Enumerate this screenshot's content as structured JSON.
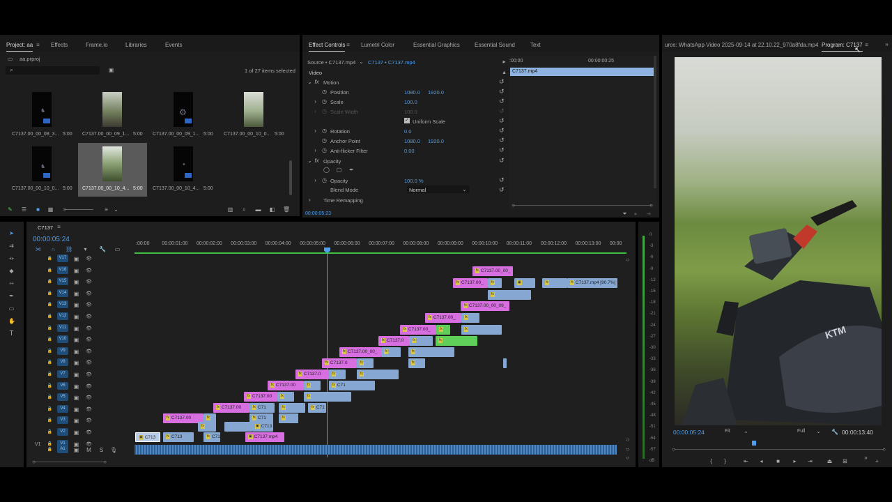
{
  "project_panel": {
    "tabs": [
      "Project: aa",
      "Effects",
      "Frame.io",
      "Libraries",
      "Events"
    ],
    "project_file": "aa.prproj",
    "items_selected": "1 of 27 items selected",
    "bins": [
      {
        "name": "C7137.00_00_08_3...",
        "duration": "5:00"
      },
      {
        "name": "C7137.00_00_09_1...",
        "duration": "5:00"
      },
      {
        "name": "C7137.00_00_09_1...",
        "duration": "5:00"
      },
      {
        "name": "C7137.00_00_10_0...",
        "duration": "5:00"
      },
      {
        "name": "C7137.00_00_10_0...",
        "duration": "5:00"
      },
      {
        "name": "C7137.00_00_10_4...",
        "duration": "5:00"
      },
      {
        "name": "C7137.00_00_10_4...",
        "duration": "5:00"
      }
    ]
  },
  "effect_controls": {
    "tabs": [
      "Effect Controls",
      "Lumetri Color",
      "Essential Graphics",
      "Essential Sound",
      "Text"
    ],
    "source": "Source • C7137.mp4",
    "sequence": "C7137 • C7137.mp4",
    "section_video": "Video",
    "motion": "Motion",
    "position_label": "Position",
    "position_x": "1080.0",
    "position_y": "1920.0",
    "scale_label": "Scale",
    "scale_val": "100.0",
    "scale_width_label": "Scale Width",
    "scale_width_val": "100.0",
    "uniform_scale": "Uniform Scale",
    "rotation_label": "Rotation",
    "rotation_val": "0.0",
    "anchor_label": "Anchor Point",
    "anchor_x": "1080.0",
    "anchor_y": "1920.0",
    "antiflicker_label": "Anti-flicker Filter",
    "antiflicker_val": "0.00",
    "opacity_section": "Opacity",
    "opacity_label": "Opacity",
    "opacity_val": "100.0 %",
    "blend_label": "Blend Mode",
    "blend_val": "Normal",
    "time_remap": "Time Remapping",
    "time_start": ":00:00",
    "time_mark": "00:00:00:25",
    "clip_name": "C7137.mp4",
    "current_time": "00:00:05:23"
  },
  "program": {
    "source_tab": "urce: WhatsApp Video 2025-09-14 at 22.10.22_970a8fda.mp4",
    "program_tab": "Program: C7137",
    "timecode": "00:00:05:24",
    "fit": "Fit",
    "quality": "Full",
    "duration": "00:00:13:40"
  },
  "timeline": {
    "sequence_name": "C7137",
    "timecode": "00:00:05:24",
    "ruler": [
      ":00:00",
      "00:00:01:00",
      "00:00:02:00",
      "00:00:03:00",
      "00:00:04:00",
      "00:00:05:00",
      "00:00:06:00",
      "00:00:07:00",
      "00:00:08:00",
      "00:00:09:00",
      "00:00:10:00",
      "00:00:11:00",
      "00:00:12:00",
      "00:00:13:00",
      "00:00"
    ],
    "tracks": [
      "V17",
      "V16",
      "V15",
      "V14",
      "V13",
      "V12",
      "V11",
      "V10",
      "V9",
      "V8",
      "V7",
      "V6",
      "V5",
      "V4",
      "V3",
      "V2",
      "V1"
    ],
    "source_patch": "V1",
    "audio_track": "A1",
    "audio_m": "M",
    "audio_s": "S",
    "meter_scale": [
      "0",
      "-3",
      "-6",
      "-9",
      "-12",
      "-15",
      "-18",
      "-21",
      "-24",
      "-27",
      "-30",
      "-33",
      "-36",
      "-39",
      "-42",
      "-45",
      "-48",
      "-51",
      "-54",
      "-57",
      "dB"
    ],
    "clips": {
      "c1": "C7137.00_00_",
      "c2": "C7137.00_",
      "c3": "C7137.mp4 [90.7%]",
      "c4": "C7137.00_00_09_",
      "c5": "C7137.00_",
      "c6": "C7137.00_",
      "c7": "C7137.0",
      "c8": "C7137.00_00_",
      "c9": "C7137.0",
      "c10": "C7137.0",
      "c11": "C7137.00",
      "c12": "C7137.00",
      "c13": "C7137.00",
      "c14": "C7137.00",
      "c15": "C71",
      "c16": "C71",
      "c17": "C71",
      "c18": "C71",
      "c19": "C713",
      "c20": "C713",
      "c21": "C713",
      "c22": "C71",
      "c23": "C7137.mp4"
    }
  }
}
